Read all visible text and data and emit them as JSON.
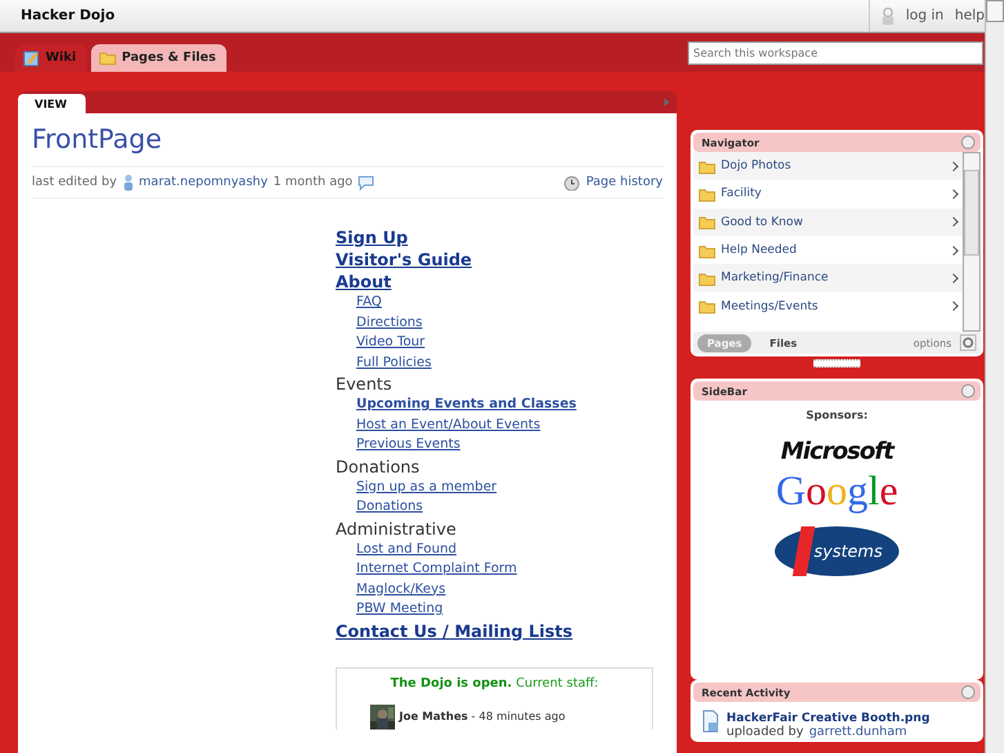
{
  "header": {
    "site_title": "Hacker Dojo",
    "links": [
      "log in",
      "help"
    ]
  },
  "tabs": [
    {
      "label": "Wiki",
      "selected": true
    },
    {
      "label": "Pages & Files",
      "selected": false
    }
  ],
  "search": {
    "placeholder": "Search this workspace"
  },
  "page": {
    "view_tab": "VIEW",
    "title": "FrontPage",
    "meta_prefix": "last edited by",
    "author": "marat.nepomnyashy",
    "time": "1 month ago",
    "history_link": "Page history",
    "links": [
      {
        "text": "Sign Up",
        "kind": "main"
      },
      {
        "text": "Visitor's Guide",
        "kind": "main"
      },
      {
        "text": "About",
        "kind": "main"
      },
      {
        "text": "FAQ",
        "kind": "sub"
      },
      {
        "text": "Directions",
        "kind": "sub"
      },
      {
        "text": "Video Tour",
        "kind": "sub"
      },
      {
        "text": "Full Policies",
        "kind": "sub"
      },
      {
        "text": "Events",
        "kind": "heading"
      },
      {
        "text": "Upcoming Events and Classes",
        "kind": "subbold"
      },
      {
        "text": "Host an Event/About Events",
        "kind": "sub"
      },
      {
        "text": "Previous Events",
        "kind": "sub"
      },
      {
        "text": "Donations",
        "kind": "heading"
      },
      {
        "text": "Sign up as a member",
        "kind": "sub"
      },
      {
        "text": "Donations",
        "kind": "sub"
      },
      {
        "text": "Administrative",
        "kind": "heading"
      },
      {
        "text": "Lost and Found",
        "kind": "sub"
      },
      {
        "text": "Internet Complaint Form",
        "kind": "sub"
      },
      {
        "text": "Maglock/Keys",
        "kind": "sub"
      },
      {
        "text": "PBW Meeting",
        "kind": "sub"
      },
      {
        "text": "Contact Us / Mailing Lists",
        "kind": "main"
      }
    ],
    "status_box": {
      "open_text": "The Dojo is open.",
      "staff_label": "Current staff:",
      "staff": [
        {
          "name": "Joe Mathes",
          "time": "- 48 minutes ago"
        }
      ]
    }
  },
  "navigator": {
    "title": "Navigator",
    "items": [
      "Dojo Photos",
      "Facility",
      "Good to Know",
      "Help Needed",
      "Marketing/Finance",
      "Meetings/Events"
    ],
    "tabs": [
      {
        "label": "Pages",
        "selected": true
      },
      {
        "label": "Files",
        "selected": false
      }
    ],
    "options": "options"
  },
  "sidebar": {
    "title": "SideBar",
    "sponsors_label": "Sponsors:",
    "sponsors": [
      {
        "name": "Microsoft",
        "kind": "microsoft"
      },
      {
        "name": "Google",
        "kind": "google"
      },
      {
        "name": "systems",
        "kind": "ixsystems"
      }
    ]
  },
  "recent_activity": {
    "title": "Recent Activity",
    "items": [
      {
        "title": "HackerFair Creative Booth.png",
        "action": "uploaded by",
        "user": "garrett.dunham"
      }
    ]
  }
}
